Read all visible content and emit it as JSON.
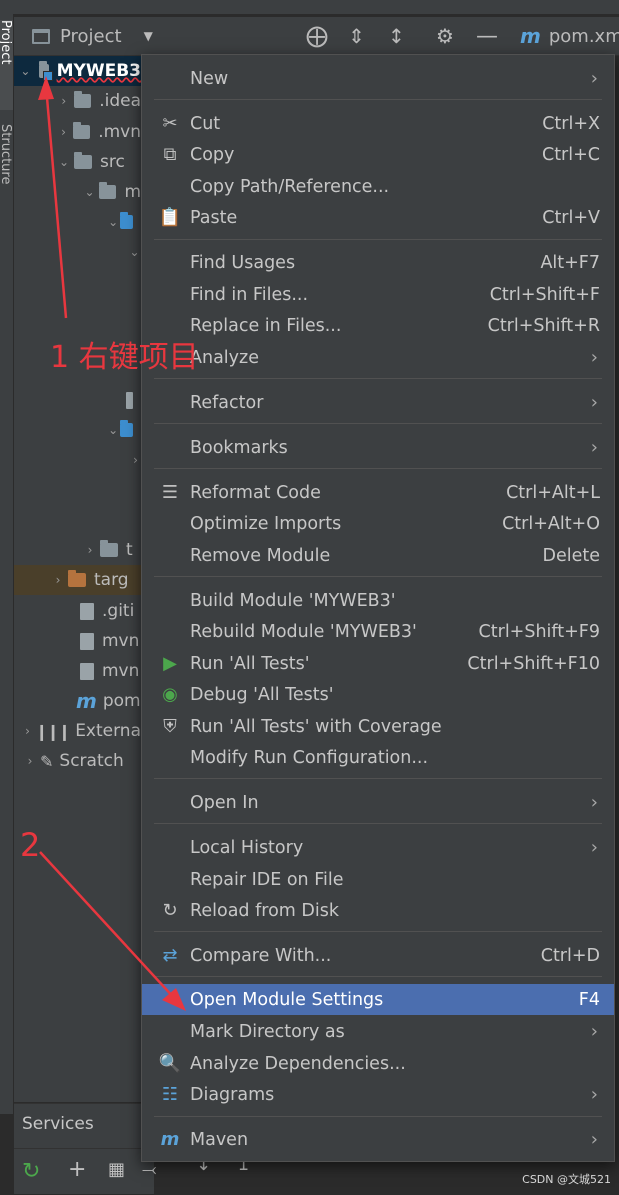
{
  "sidebar": {
    "project_tab": "Project",
    "structure_tab": "Structure"
  },
  "toolbar": {
    "panel_title": "Project",
    "file_tab": "pom.xml"
  },
  "tree": {
    "rows": [
      {
        "label": "MYWEB3",
        "level": 0,
        "expanded": true,
        "icon": "module-folder-icon",
        "selected": true
      },
      {
        "label": ".idea",
        "level": 1,
        "expanded": false,
        "icon": "folder-icon"
      },
      {
        "label": ".mvn",
        "level": 1,
        "expanded": false,
        "icon": "folder-icon"
      },
      {
        "label": "src",
        "level": 1,
        "expanded": true,
        "icon": "folder-icon"
      },
      {
        "label": "m",
        "level": 2,
        "expanded": true,
        "icon": "folder-icon"
      },
      {
        "label": "",
        "level": 3,
        "expanded": true,
        "icon": "source-folder-icon"
      },
      {
        "label": "t",
        "level": 2,
        "expanded": false,
        "icon": "folder-icon"
      },
      {
        "label": "targ",
        "level": 1,
        "expanded": false,
        "icon": "orange-folder-icon"
      },
      {
        "label": ".giti",
        "level": 1,
        "icon": "file-icon"
      },
      {
        "label": "mvn",
        "level": 1,
        "icon": "script-icon"
      },
      {
        "label": "mvn",
        "level": 1,
        "icon": "file-icon"
      },
      {
        "label": "pom",
        "level": 1,
        "icon": "maven-icon"
      },
      {
        "label": "Externa",
        "level": 0,
        "expanded": false,
        "icon": "library-icon"
      },
      {
        "label": "Scratch",
        "level": 0,
        "expanded": false,
        "icon": "scratch-icon"
      }
    ]
  },
  "menu": {
    "new": "New",
    "cut": "Cut",
    "cut_sc": "Ctrl+X",
    "copy": "Copy",
    "copy_sc": "Ctrl+C",
    "copy_path": "Copy Path/Reference...",
    "paste": "Paste",
    "paste_sc": "Ctrl+V",
    "find_usages": "Find Usages",
    "find_usages_sc": "Alt+F7",
    "find_in_files": "Find in Files...",
    "find_in_files_sc": "Ctrl+Shift+F",
    "replace_in_files": "Replace in Files...",
    "replace_in_files_sc": "Ctrl+Shift+R",
    "analyze": "Analyze",
    "refactor": "Refactor",
    "bookmarks": "Bookmarks",
    "reformat": "Reformat Code",
    "reformat_sc": "Ctrl+Alt+L",
    "optimize": "Optimize Imports",
    "optimize_sc": "Ctrl+Alt+O",
    "remove_module": "Remove Module",
    "remove_module_sc": "Delete",
    "build_module": "Build Module 'MYWEB3'",
    "rebuild_module": "Rebuild Module 'MYWEB3'",
    "rebuild_module_sc": "Ctrl+Shift+F9",
    "run_tests": "Run 'All Tests'",
    "run_tests_sc": "Ctrl+Shift+F10",
    "debug_tests": "Debug 'All Tests'",
    "run_coverage": "Run 'All Tests' with Coverage",
    "modify_run": "Modify Run Configuration...",
    "open_in": "Open In",
    "local_history": "Local History",
    "repair_ide": "Repair IDE on File",
    "reload_disk": "Reload from Disk",
    "compare_with": "Compare With...",
    "compare_with_sc": "Ctrl+D",
    "open_module_settings": "Open Module Settings",
    "open_module_settings_sc": "F4",
    "mark_directory": "Mark Directory as",
    "analyze_deps": "Analyze Dependencies...",
    "diagrams": "Diagrams",
    "maven": "Maven"
  },
  "services": {
    "title": "Services"
  },
  "annotations": {
    "step1": "1 右键项目",
    "step2": "2"
  },
  "watermark": "CSDN @文城521",
  "colors": {
    "highlight": "#4b6eaf",
    "annotation": "#e8373f",
    "run_green": "#4ca74c",
    "maven_blue": "#5ba3d9"
  }
}
